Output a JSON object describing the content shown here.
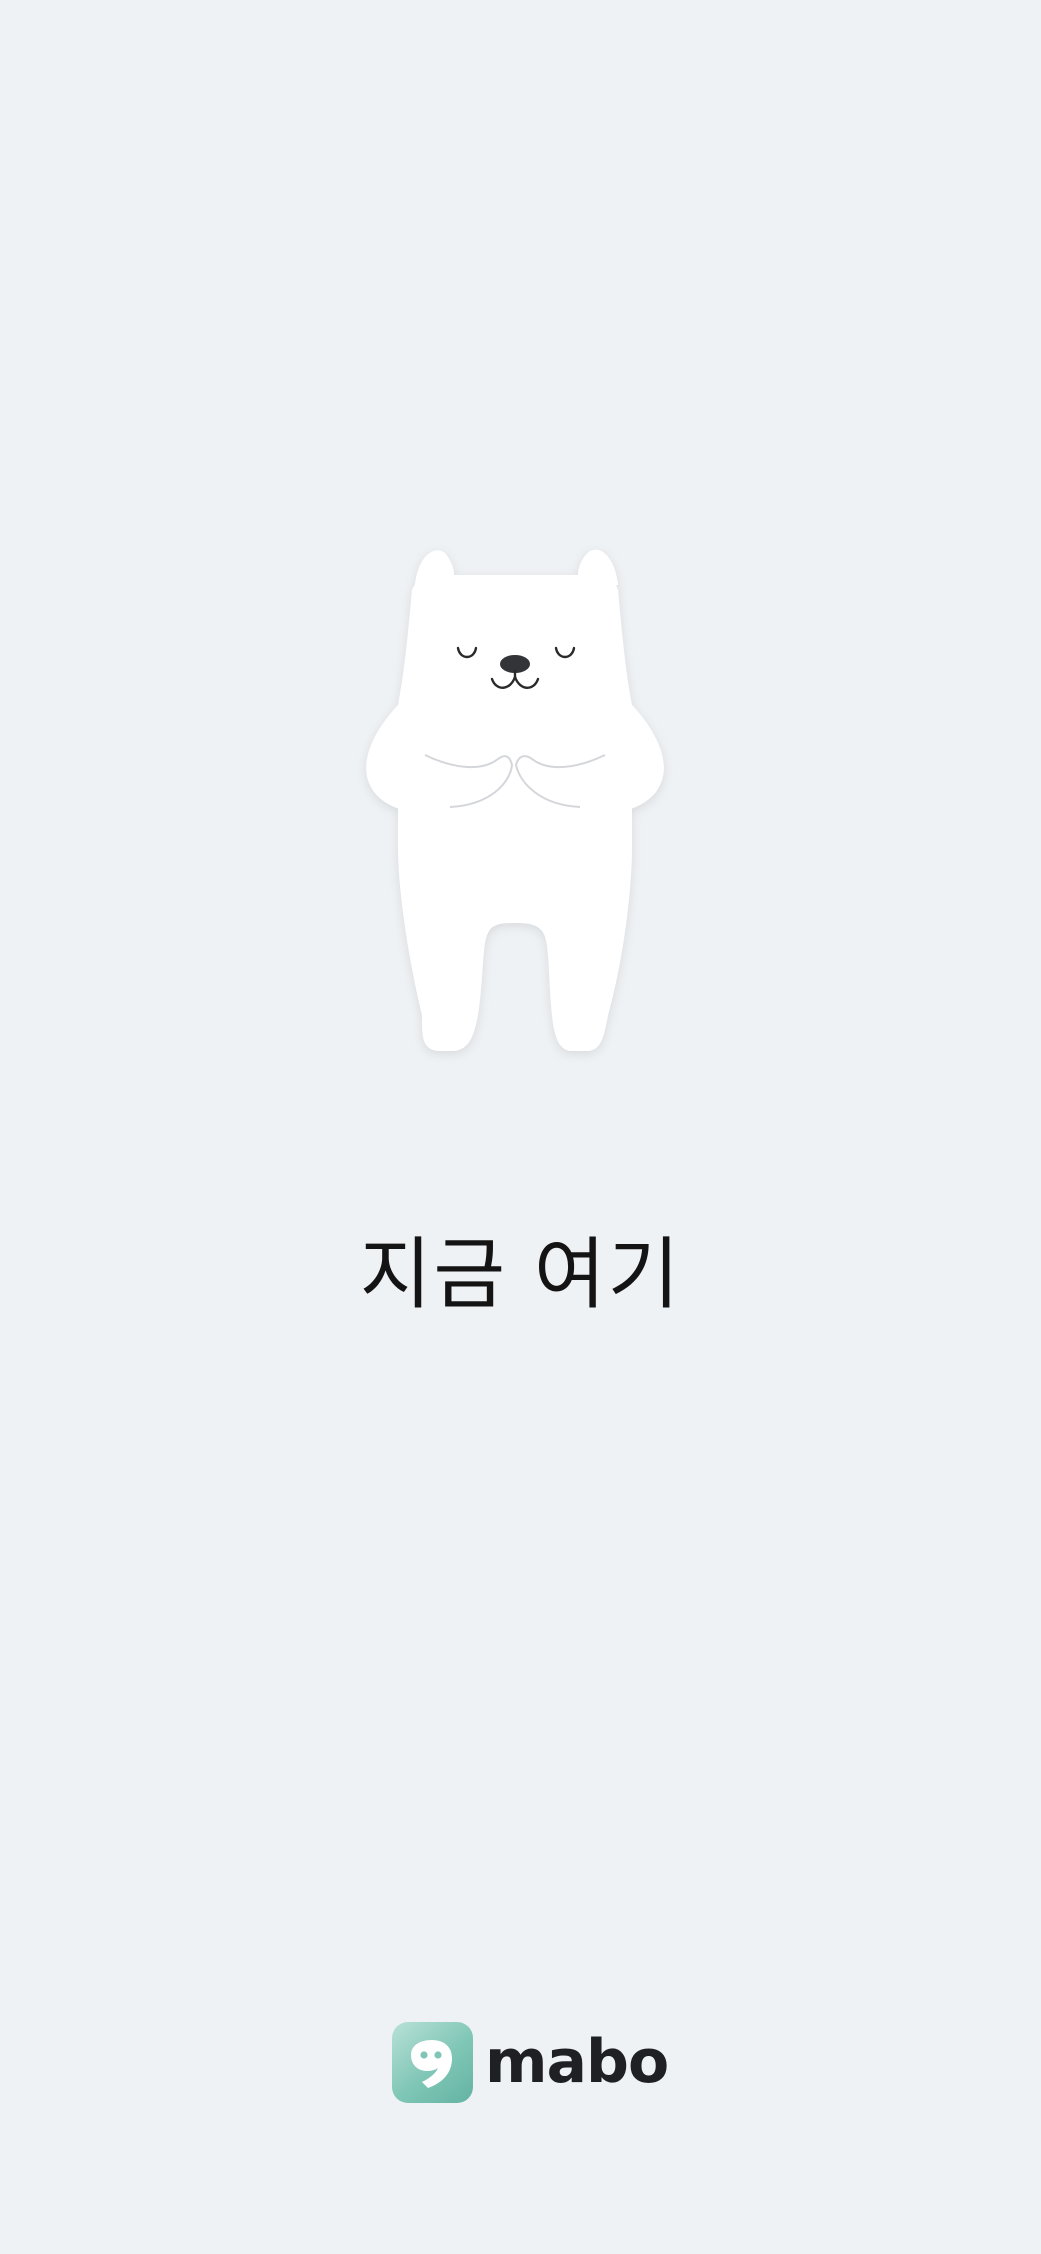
{
  "tagline": "지금 여기",
  "brand": {
    "name": "mabo",
    "logo_icon": "speech-bubble-nine-icon",
    "logo_colors": [
      "#b9e1d7",
      "#64b3a3"
    ]
  },
  "mascot": {
    "icon": "meditating-polar-bear-illustration"
  },
  "colors": {
    "background": "#eff2f5",
    "text": "#141414"
  }
}
